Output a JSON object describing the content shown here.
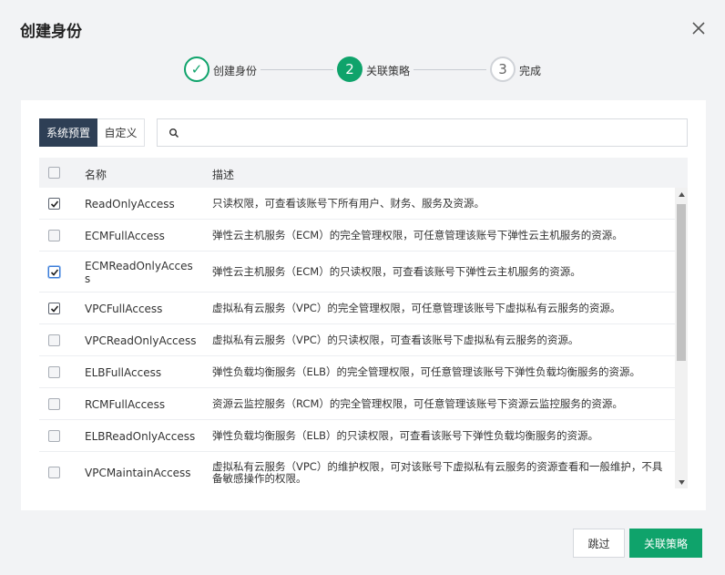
{
  "dialog": {
    "title": "创建身份"
  },
  "steps": [
    {
      "label": "创建身份",
      "marker": "✓",
      "state": "done"
    },
    {
      "label": "关联策略",
      "marker": "2",
      "state": "active"
    },
    {
      "label": "完成",
      "marker": "3",
      "state": "todo"
    }
  ],
  "filter": {
    "tabs": [
      "系统预置",
      "自定义"
    ],
    "active_tab": "系统预置",
    "search_value": "",
    "search_placeholder": ""
  },
  "table": {
    "headers": {
      "name": "名称",
      "desc": "描述"
    },
    "rows": [
      {
        "name": "ReadOnlyAccess",
        "desc": "只读权限，可查看该账号下所有用户、财务、服务及资源。",
        "checked": true
      },
      {
        "name": "ECMFullAccess",
        "desc": "弹性云主机服务（ECM）的完全管理权限，可任意管理该账号下弹性云主机服务的资源。",
        "checked": false
      },
      {
        "name": "ECMReadOnlyAccess",
        "desc": "弹性云主机服务（ECM）的只读权限，可查看该账号下弹性云主机服务的资源。",
        "checked": true
      },
      {
        "name": "VPCFullAccess",
        "desc": "虚拟私有云服务（VPC）的完全管理权限，可任意管理该账号下虚拟私有云服务的资源。",
        "checked": true
      },
      {
        "name": "VPCReadOnlyAccess",
        "desc": "虚拟私有云服务（VPC）的只读权限，可查看该账号下虚拟私有云服务的资源。",
        "checked": false
      },
      {
        "name": "ELBFullAccess",
        "desc": "弹性负载均衡服务（ELB）的完全管理权限，可任意管理该账号下弹性负载均衡服务的资源。",
        "checked": false
      },
      {
        "name": "RCMFullAccess",
        "desc": "资源云监控服务（RCM）的完全管理权限，可任意管理该账号下资源云监控服务的资源。",
        "checked": false
      },
      {
        "name": "ELBReadOnlyAccess",
        "desc": "弹性负载均衡服务（ELB）的只读权限，可查看该账号下弹性负载均衡服务的资源。",
        "checked": false
      },
      {
        "name": "VPCMaintainAccess",
        "desc": "虚拟私有云服务（VPC）的维护权限，可对该账号下虚拟私有云服务的资源查看和一般维护，不具备敏感操作的权限。",
        "checked": false
      }
    ]
  },
  "footer": {
    "skip_label": "跳过",
    "primary_label": "关联策略"
  },
  "colors": {
    "accent": "#0fa36b",
    "dark_tab": "#2e3f55"
  }
}
